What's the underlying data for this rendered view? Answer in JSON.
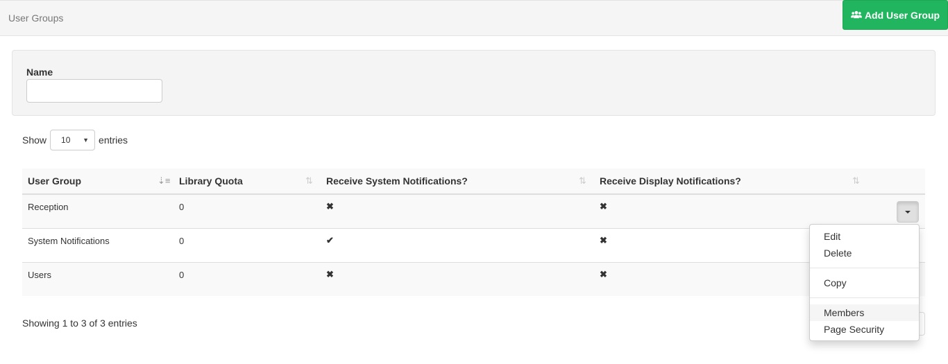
{
  "header": {
    "title": "User Groups",
    "add_button": {
      "label": "Add User Group",
      "icon": "users-icon",
      "color": "#22b55f"
    }
  },
  "filter": {
    "name_label": "Name",
    "name_value": "",
    "name_placeholder": ""
  },
  "length_menu": {
    "prefix": "Show",
    "selected": "10",
    "suffix": "entries"
  },
  "table": {
    "columns": [
      {
        "label": "User Group",
        "sort": "ascending"
      },
      {
        "label": "Library Quota",
        "sort": "none"
      },
      {
        "label": "Receive System Notifications?",
        "sort": "none"
      },
      {
        "label": "Receive Display Notifications?",
        "sort": "none"
      }
    ],
    "rows": [
      {
        "user_group": "Reception",
        "library_quota": "0",
        "system_notifications": "✖",
        "display_notifications": "✖"
      },
      {
        "user_group": "System Notifications",
        "library_quota": "0",
        "system_notifications": "✔",
        "display_notifications": "✖"
      },
      {
        "user_group": "Users",
        "library_quota": "0",
        "system_notifications": "✖",
        "display_notifications": "✖"
      }
    ]
  },
  "row_menu": {
    "items": [
      "Edit",
      "Delete",
      "Copy",
      "Members",
      "Page Security"
    ],
    "hovered": "Members"
  },
  "footer": {
    "info": "Showing 1 to 3 of 3 entries"
  }
}
